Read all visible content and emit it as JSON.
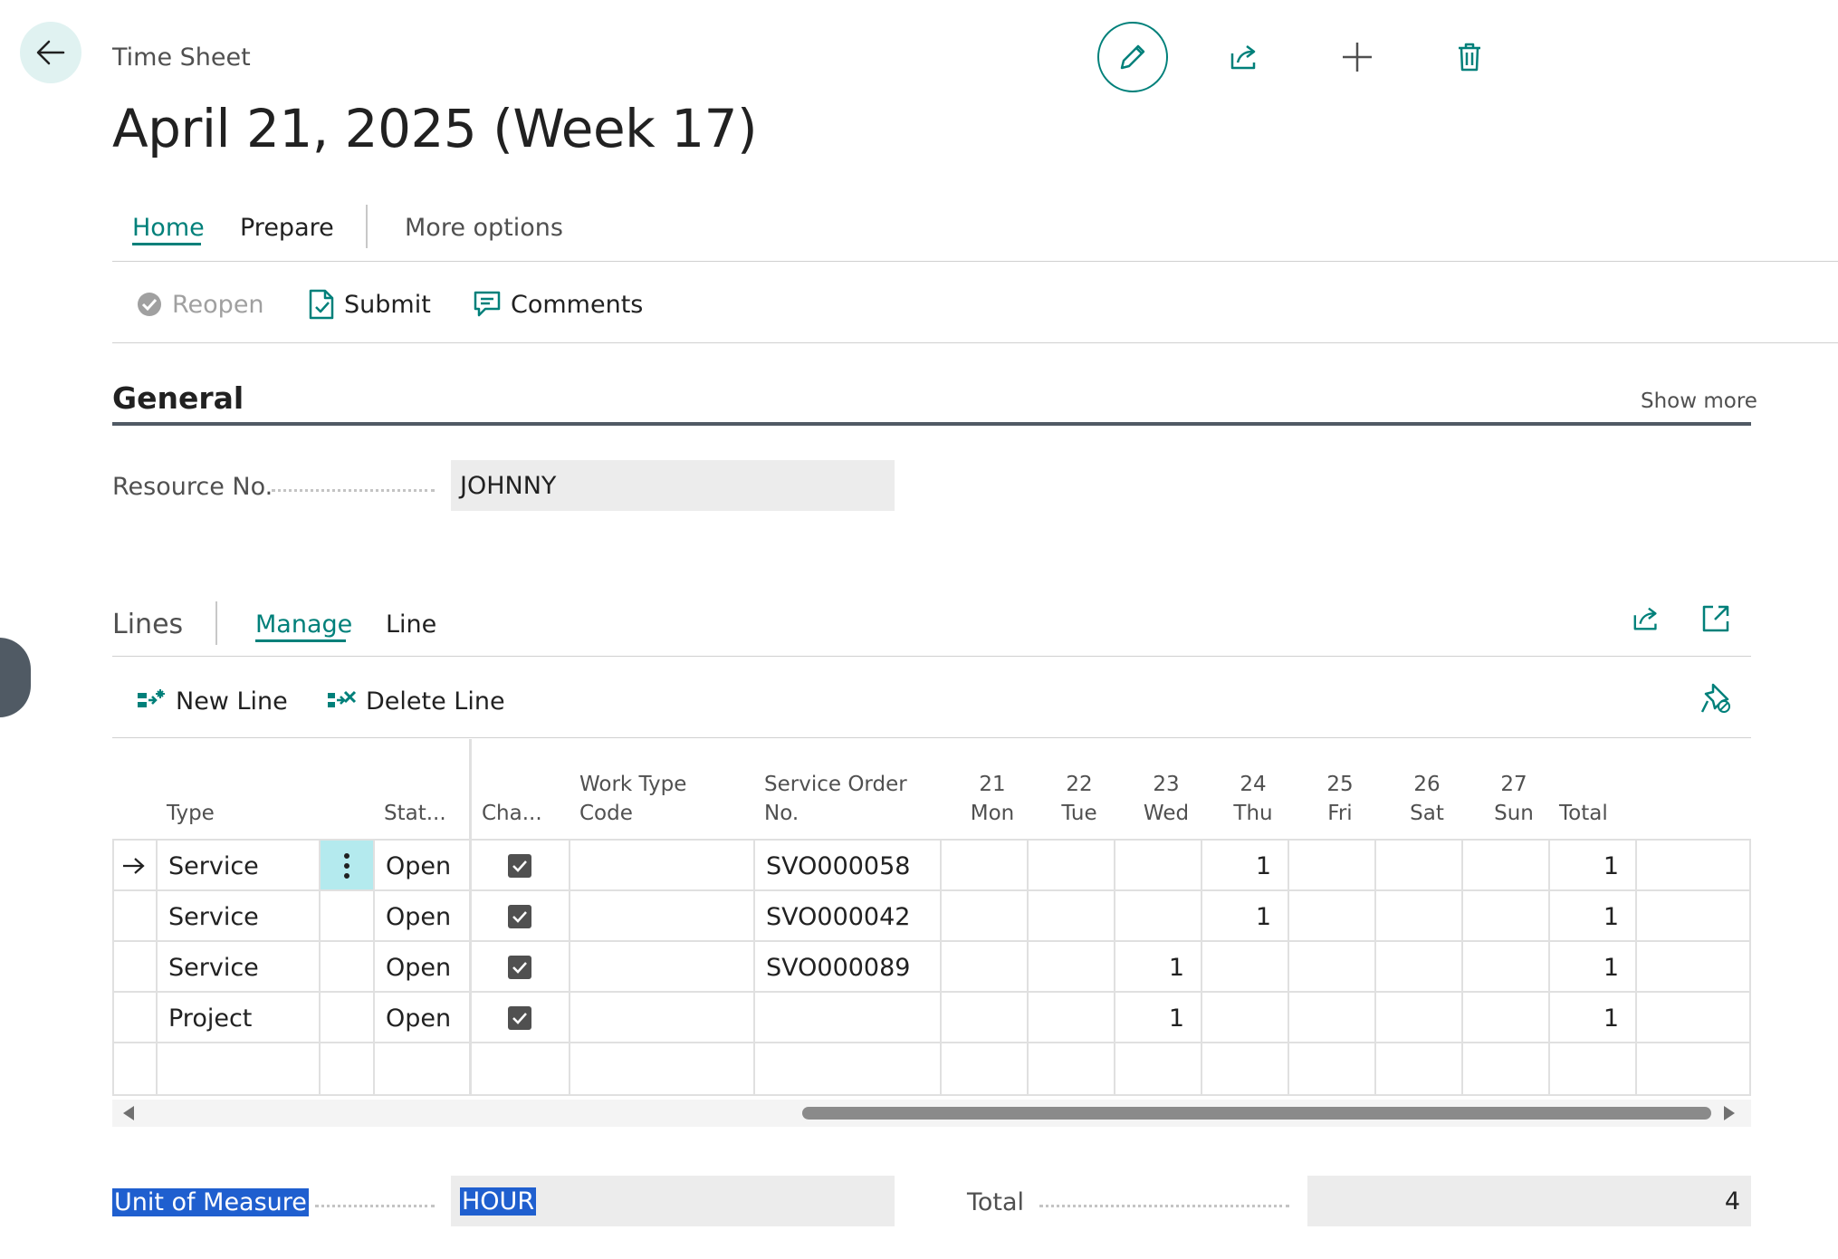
{
  "header": {
    "caption": "Time Sheet",
    "title": "April 21, 2025 (Week 17)"
  },
  "action_tabs": {
    "home": "Home",
    "prepare": "Prepare",
    "more": "More options"
  },
  "actions": {
    "reopen": "Reopen",
    "submit": "Submit",
    "comments": "Comments"
  },
  "general": {
    "title": "General",
    "show_more": "Show more",
    "resource_label": "Resource No.",
    "resource_value": "JOHNNY"
  },
  "lines": {
    "title": "Lines",
    "tab_manage": "Manage",
    "tab_line": "Line",
    "new_line": "New Line",
    "delete_line": "Delete Line",
    "columns": {
      "type": "Type",
      "status": "Stat...",
      "chargeable": "Cha...",
      "work_type_1": "Work Type",
      "work_type_2": "Code",
      "service_order_1": "Service Order",
      "service_order_2": "No.",
      "d21a": "21",
      "d21b": "Mon",
      "d22a": "22",
      "d22b": "Tue",
      "d23a": "23",
      "d23b": "Wed",
      "d24a": "24",
      "d24b": "Thu",
      "d25a": "25",
      "d25b": "Fri",
      "d26a": "26",
      "d26b": "Sat",
      "d27a": "27",
      "d27b": "Sun",
      "total": "Total"
    },
    "rows": [
      {
        "type": "Service",
        "status": "Open",
        "chargeable": true,
        "work_type": "",
        "service_order": "SVO000058",
        "mon": "",
        "tue": "",
        "wed": "",
        "thu": "1",
        "fri": "",
        "sat": "",
        "sun": "",
        "total": "1"
      },
      {
        "type": "Service",
        "status": "Open",
        "chargeable": true,
        "work_type": "",
        "service_order": "SVO000042",
        "mon": "",
        "tue": "",
        "wed": "",
        "thu": "1",
        "fri": "",
        "sat": "",
        "sun": "",
        "total": "1"
      },
      {
        "type": "Service",
        "status": "Open",
        "chargeable": true,
        "work_type": "",
        "service_order": "SVO000089",
        "mon": "",
        "tue": "",
        "wed": "1",
        "thu": "",
        "fri": "",
        "sat": "",
        "sun": "",
        "total": "1"
      },
      {
        "type": "Project",
        "status": "Open",
        "chargeable": true,
        "work_type": "",
        "service_order": "",
        "mon": "",
        "tue": "",
        "wed": "1",
        "thu": "",
        "fri": "",
        "sat": "",
        "sun": "",
        "total": "1"
      }
    ]
  },
  "footer": {
    "uom_label": "Unit of Measure",
    "uom_value": "HOUR",
    "total_label": "Total",
    "total_value": "4"
  },
  "colors": {
    "accent": "#00807a",
    "selection": "#1f5fcf"
  }
}
